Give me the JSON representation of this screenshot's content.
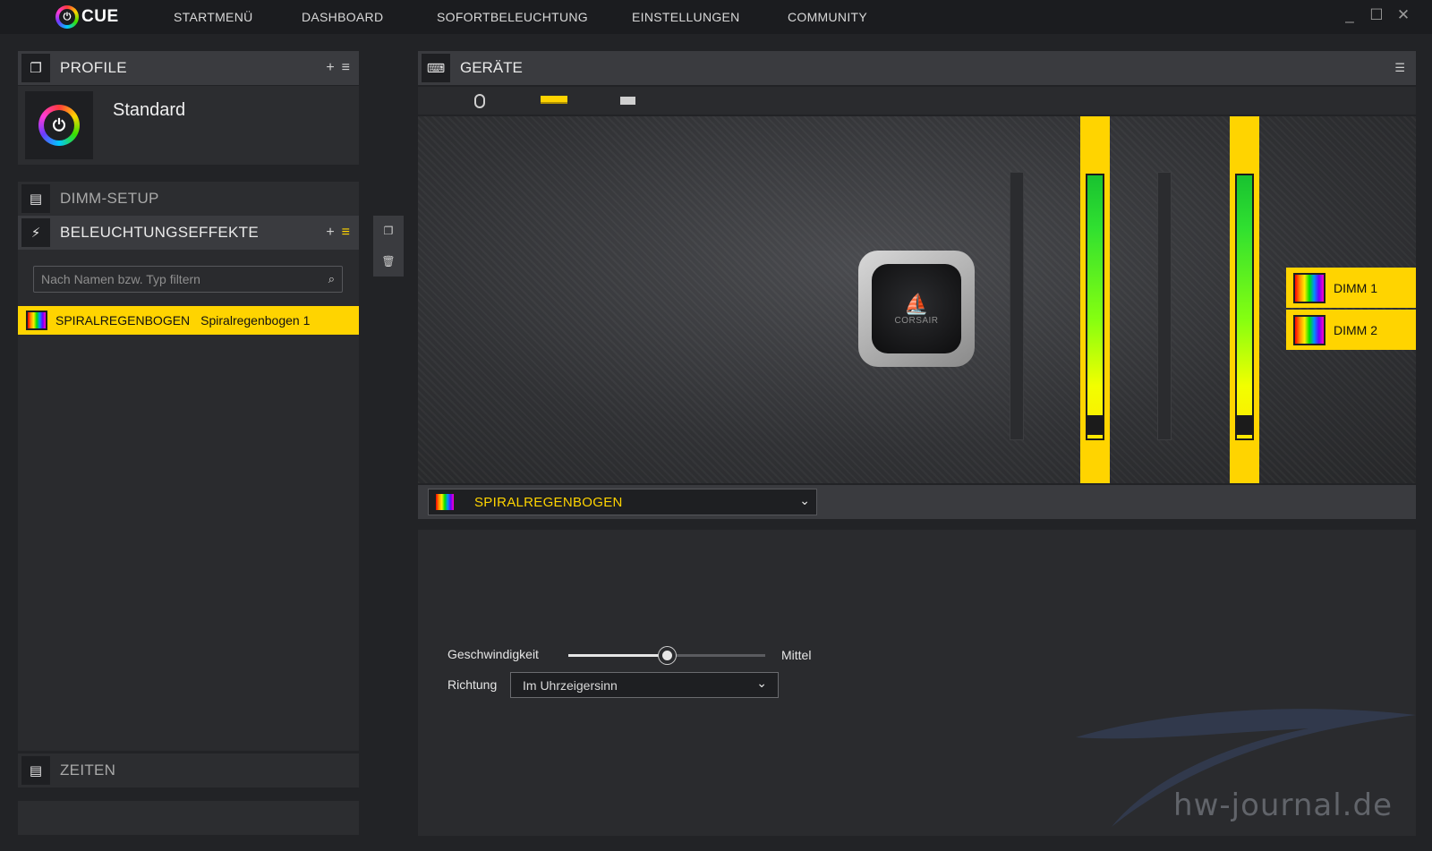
{
  "app": {
    "logo_text": "CUE",
    "nav": [
      "STARTMENÜ",
      "DASHBOARD",
      "SOFORTBELEUCHTUNG",
      "EINSTELLUNGEN",
      "COMMUNITY"
    ],
    "window_controls": [
      "minimize-icon",
      "maximize-icon",
      "close-icon"
    ]
  },
  "left": {
    "profiles": {
      "title": "PROFILE",
      "actions": [
        "+",
        "≡"
      ],
      "profile_name": "Standard"
    },
    "dimm_setup": {
      "title": "DIMM-SETUP"
    },
    "effects": {
      "title": "BELEUCHTUNGSEFFEKTE",
      "actions": [
        "+",
        "≡"
      ],
      "filter_placeholder": "Nach Namen bzw. Typ filtern",
      "items": [
        {
          "type": "SPIRALREGENBOGEN",
          "name": "Spiralregenbogen 1"
        }
      ]
    },
    "zeiten": {
      "title": "ZEITEN"
    }
  },
  "devices": {
    "title": "GERÄTE",
    "tabs": [
      "mouse-icon",
      "ram-icon",
      "keyboard-icon"
    ],
    "dimms": [
      "DIMM 1",
      "DIMM 2"
    ],
    "pump_brand": "CORSAIR"
  },
  "effect_settings": {
    "selected_effect": "SPIRALREGENBOGEN",
    "speed_label": "Geschwindigkeit",
    "speed_value_label": "Mittel",
    "speed_fraction": 0.5,
    "direction_label": "Richtung",
    "direction_value": "Im Uhrzeigersinn"
  },
  "watermark": "hw-journal.de",
  "colors": {
    "accent": "#ffd400",
    "background": "#222326",
    "panel": "#3a3b3f"
  }
}
